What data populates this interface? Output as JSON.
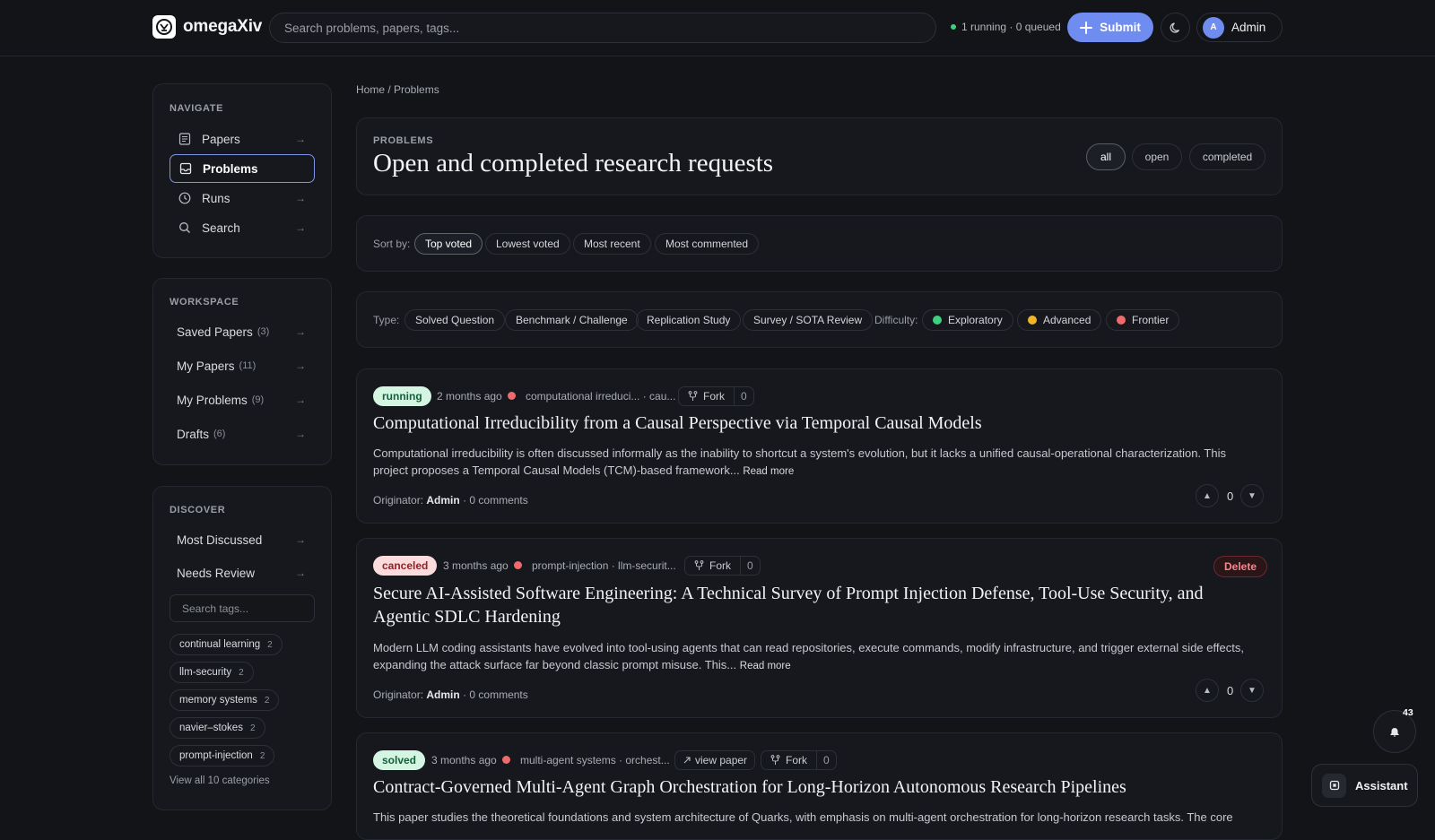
{
  "header": {
    "app_name": "omegaXiv",
    "search_placeholder": "Search problems, papers, tags...",
    "status_text": "1 running · 0 queued",
    "submit_label": "Submit",
    "avatar_initial": "A",
    "user_name": "Admin"
  },
  "sidebar": {
    "navigate": {
      "heading": "NAVIGATE",
      "items": [
        {
          "label": "Papers",
          "icon": "document-icon"
        },
        {
          "label": "Problems",
          "icon": "inbox-icon"
        },
        {
          "label": "Runs",
          "icon": "clock-icon"
        },
        {
          "label": "Search",
          "icon": "search-icon"
        }
      ]
    },
    "workspace": {
      "heading": "WORKSPACE",
      "items": [
        {
          "label": "Saved Papers",
          "count": "(3)"
        },
        {
          "label": "My Papers",
          "count": "(11)"
        },
        {
          "label": "My Problems",
          "count": "(9)"
        },
        {
          "label": "Drafts",
          "count": "(6)"
        }
      ]
    },
    "discover": {
      "heading": "DISCOVER",
      "items": [
        {
          "label": "Most Discussed"
        },
        {
          "label": "Needs Review"
        }
      ],
      "tag_search_placeholder": "Search tags...",
      "tags": [
        {
          "label": "continual learning",
          "count": "2"
        },
        {
          "label": "llm-security",
          "count": "2"
        },
        {
          "label": "memory systems",
          "count": "2"
        },
        {
          "label": "navier–stokes",
          "count": "2"
        },
        {
          "label": "prompt-injection",
          "count": "2"
        }
      ],
      "view_all": "View all 10 categories"
    }
  },
  "breadcrumb": "Home / Problems",
  "page": {
    "eyebrow": "PROBLEMS",
    "title": "Open and completed research requests",
    "status_filters": [
      "all",
      "open",
      "completed"
    ],
    "selected_status": "all"
  },
  "sort": {
    "label": "Sort by:",
    "options": [
      "Top voted",
      "Lowest voted",
      "Most recent",
      "Most commented"
    ],
    "selected": "Top voted"
  },
  "filters": {
    "type_label": "Type:",
    "types": [
      "Solved Question",
      "Benchmark / Challenge",
      "Replication Study",
      "Survey / SOTA Review"
    ],
    "difficulty_label": "Difficulty:",
    "difficulties": [
      {
        "label": "Exploratory",
        "color": "#3fd07f"
      },
      {
        "label": "Advanced",
        "color": "#f0b429"
      },
      {
        "label": "Frontier",
        "color": "#ef6b6b"
      }
    ]
  },
  "problems": [
    {
      "status": "running",
      "status_bg": "#d5f5e3",
      "status_fg": "#14603a",
      "time": "2 months ago",
      "tags": "computational irreduci... · cau...",
      "fork_label": "Fork",
      "fork_count": "0",
      "title": "Computational Irreducibility from a Causal Perspective via Temporal Causal Models",
      "summary": "Computational irreducibility is often discussed informally as the inability to shortcut a system's evolution, but it lacks a unified causal-operational characterization. This project proposes a Temporal Causal Models (TCM)-based framework...",
      "read_more": "Read more",
      "originator_label": "Originator:",
      "originator": "Admin",
      "comments": "· 0 comments",
      "votes": "0"
    },
    {
      "status": "canceled",
      "status_bg": "#fbdcdc",
      "status_fg": "#9b1c24",
      "time": "3 months ago",
      "tags": "prompt-injection · llm-securit...",
      "fork_label": "Fork",
      "fork_count": "0",
      "delete_label": "Delete",
      "title": "Secure AI-Assisted Software Engineering: A Technical Survey of Prompt Injection Defense, Tool-Use Security, and Agentic SDLC Hardening",
      "summary": "Modern LLM coding assistants have evolved into tool-using agents that can read repositories, execute commands, modify infrastructure, and trigger external side effects, expanding the attack surface far beyond classic prompt misuse. This...",
      "read_more": "Read more",
      "originator_label": "Originator:",
      "originator": "Admin",
      "comments": "· 0 comments",
      "votes": "0"
    },
    {
      "status": "solved",
      "status_bg": "#d5f5e3",
      "status_fg": "#14603a",
      "time": "3 months ago",
      "tags": "multi-agent systems · orchest...",
      "view_paper": "view paper",
      "fork_label": "Fork",
      "fork_count": "0",
      "title": "Contract-Governed Multi-Agent Graph Orchestration for Long-Horizon Autonomous Research Pipelines",
      "summary": "This paper studies the theoretical foundations and system architecture of Quarks, with emphasis on multi-agent orchestration for long-horizon research tasks. The core"
    }
  ],
  "floating": {
    "notification_count": "43",
    "assistant_label": "Assistant"
  }
}
